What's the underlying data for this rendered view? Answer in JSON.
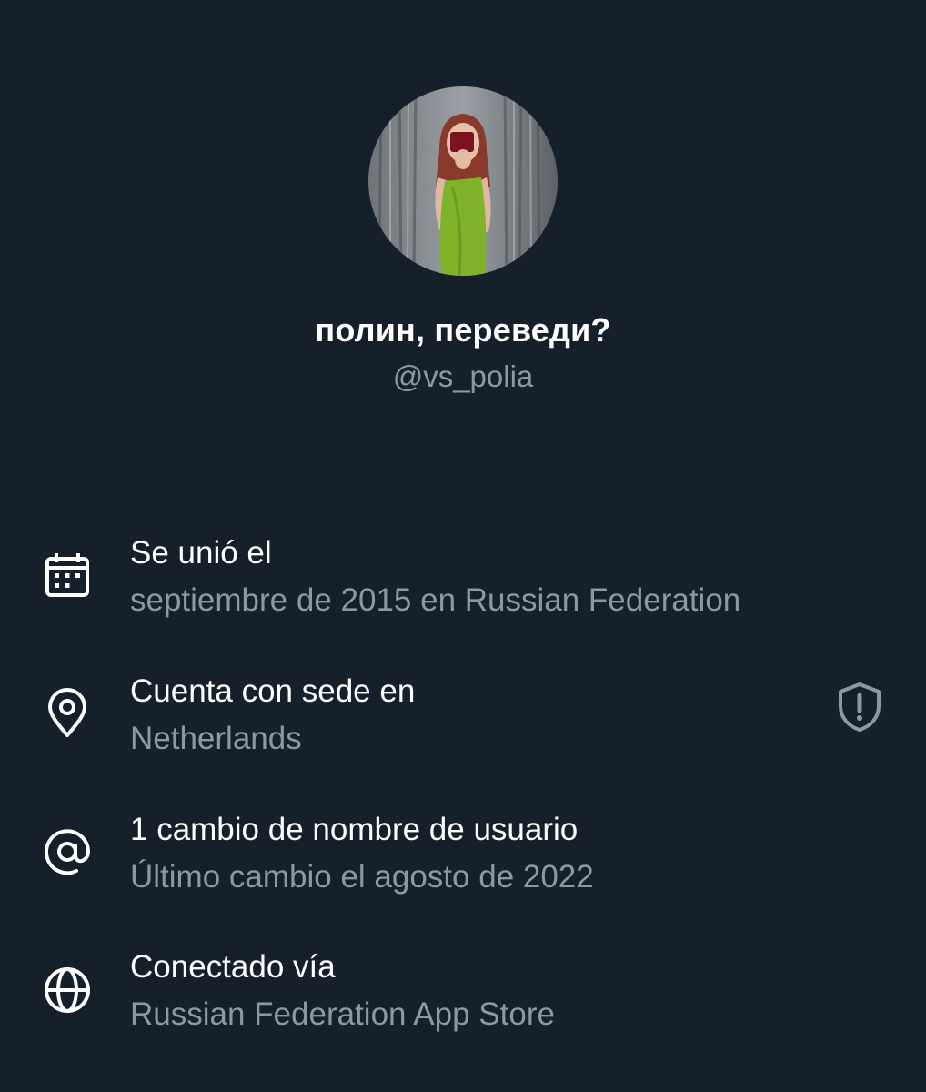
{
  "profile": {
    "display_name": "полин, переведи?",
    "handle": "@vs_polia"
  },
  "rows": [
    {
      "icon": "calendar-icon",
      "title": "Se unió el",
      "subtitle": "septiembre de 2015 en Russian Federation"
    },
    {
      "icon": "location-pin-icon",
      "title": "Cuenta con sede en",
      "subtitle": "Netherlands",
      "trailing_icon": "shield-alert-icon"
    },
    {
      "icon": "at-sign-icon",
      "title": "1 cambio de nombre de usuario",
      "subtitle": "Último cambio el agosto de 2022"
    },
    {
      "icon": "globe-icon",
      "title": "Conectado vía",
      "subtitle": "Russian Federation App Store"
    }
  ],
  "colors": {
    "background": "#15202b",
    "primary_text": "#ffffff",
    "secondary_text": "#8b98a5"
  }
}
